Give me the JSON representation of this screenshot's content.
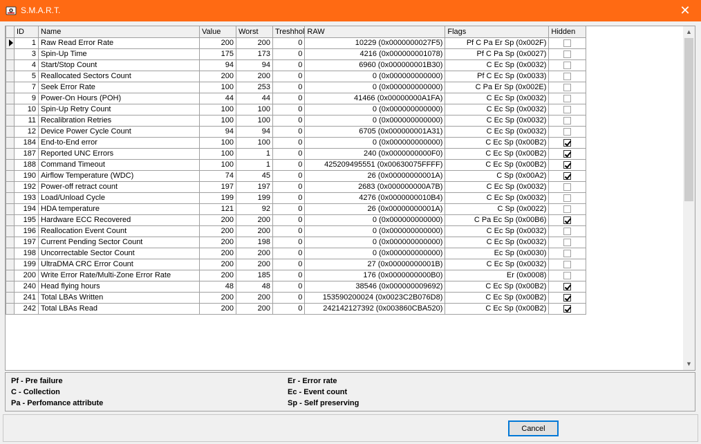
{
  "window": {
    "title": "S.M.A.R.T.",
    "icon": "hard-drive-icon",
    "close_glyph": "✕",
    "accent_color": "#ff6a13"
  },
  "table": {
    "columns": [
      "ID",
      "Name",
      "Value",
      "Worst",
      "Treshhol",
      "RAW",
      "Flags",
      "Hidden"
    ],
    "rows": [
      {
        "id": "1",
        "name": "Raw Read Error Rate",
        "value": "200",
        "worst": "200",
        "threshold": "0",
        "raw": "10229 (0x0000000027F5)",
        "flags": "Pf C Pa Er Sp  (0x002F)",
        "hidden": false
      },
      {
        "id": "3",
        "name": "Spin-Up Time",
        "value": "175",
        "worst": "173",
        "threshold": "0",
        "raw": "4216 (0x000000001078)",
        "flags": "Pf C Pa Sp  (0x0027)",
        "hidden": false
      },
      {
        "id": "4",
        "name": "Start/Stop Count",
        "value": "94",
        "worst": "94",
        "threshold": "0",
        "raw": "6960 (0x000000001B30)",
        "flags": "C Ec Sp  (0x0032)",
        "hidden": false
      },
      {
        "id": "5",
        "name": "Reallocated Sectors Count",
        "value": "200",
        "worst": "200",
        "threshold": "0",
        "raw": "0 (0x000000000000)",
        "flags": "Pf C Ec Sp  (0x0033)",
        "hidden": false
      },
      {
        "id": "7",
        "name": "Seek Error Rate",
        "value": "100",
        "worst": "253",
        "threshold": "0",
        "raw": "0 (0x000000000000)",
        "flags": "C Pa Er Sp  (0x002E)",
        "hidden": false
      },
      {
        "id": "9",
        "name": "Power-On Hours (POH)",
        "value": "44",
        "worst": "44",
        "threshold": "0",
        "raw": "41466 (0x00000000A1FA)",
        "flags": "C Ec Sp  (0x0032)",
        "hidden": false
      },
      {
        "id": "10",
        "name": "Spin-Up Retry Count",
        "value": "100",
        "worst": "100",
        "threshold": "0",
        "raw": "0 (0x000000000000)",
        "flags": "C Ec Sp  (0x0032)",
        "hidden": false
      },
      {
        "id": "11",
        "name": "Recalibration Retries",
        "value": "100",
        "worst": "100",
        "threshold": "0",
        "raw": "0 (0x000000000000)",
        "flags": "C Ec Sp  (0x0032)",
        "hidden": false
      },
      {
        "id": "12",
        "name": "Device Power Cycle Count",
        "value": "94",
        "worst": "94",
        "threshold": "0",
        "raw": "6705 (0x000000001A31)",
        "flags": "C Ec Sp  (0x0032)",
        "hidden": false
      },
      {
        "id": "184",
        "name": "End-to-End error",
        "value": "100",
        "worst": "100",
        "threshold": "0",
        "raw": "0 (0x000000000000)",
        "flags": "C Ec Sp  (0x00B2)",
        "hidden": true
      },
      {
        "id": "187",
        "name": "Reported UNC Errors",
        "value": "100",
        "worst": "1",
        "threshold": "0",
        "raw": "240 (0x0000000000F0)",
        "flags": "C Ec Sp  (0x00B2)",
        "hidden": true
      },
      {
        "id": "188",
        "name": "Command Timeout",
        "value": "100",
        "worst": "1",
        "threshold": "0",
        "raw": "425209495551 (0x00630075FFFF)",
        "flags": "C Ec Sp  (0x00B2)",
        "hidden": true
      },
      {
        "id": "190",
        "name": "Airflow Temperature (WDC)",
        "value": "74",
        "worst": "45",
        "threshold": "0",
        "raw": "26 (0x00000000001A)",
        "flags": "C Sp  (0x00A2)",
        "hidden": true
      },
      {
        "id": "192",
        "name": "Power-off retract count",
        "value": "197",
        "worst": "197",
        "threshold": "0",
        "raw": "2683 (0x000000000A7B)",
        "flags": "C Ec Sp  (0x0032)",
        "hidden": false
      },
      {
        "id": "193",
        "name": "Load/Unload Cycle",
        "value": "199",
        "worst": "199",
        "threshold": "0",
        "raw": "4276 (0x0000000010B4)",
        "flags": "C Ec Sp  (0x0032)",
        "hidden": false
      },
      {
        "id": "194",
        "name": "HDA temperature",
        "value": "121",
        "worst": "92",
        "threshold": "0",
        "raw": "26 (0x00000000001A)",
        "flags": "C Sp  (0x0022)",
        "hidden": false
      },
      {
        "id": "195",
        "name": "Hardware ECC Recovered",
        "value": "200",
        "worst": "200",
        "threshold": "0",
        "raw": "0 (0x000000000000)",
        "flags": "C Pa Ec Sp  (0x00B6)",
        "hidden": true
      },
      {
        "id": "196",
        "name": "Reallocation Event Count",
        "value": "200",
        "worst": "200",
        "threshold": "0",
        "raw": "0 (0x000000000000)",
        "flags": "C Ec Sp  (0x0032)",
        "hidden": false
      },
      {
        "id": "197",
        "name": "Current Pending Sector Count",
        "value": "200",
        "worst": "198",
        "threshold": "0",
        "raw": "0 (0x000000000000)",
        "flags": "C Ec Sp  (0x0032)",
        "hidden": false
      },
      {
        "id": "198",
        "name": "Uncorrectable Sector Count",
        "value": "200",
        "worst": "200",
        "threshold": "0",
        "raw": "0 (0x000000000000)",
        "flags": "Ec Sp  (0x0030)",
        "hidden": false
      },
      {
        "id": "199",
        "name": "UltraDMA CRC Error Count",
        "value": "200",
        "worst": "200",
        "threshold": "0",
        "raw": "27 (0x00000000001B)",
        "flags": "C Ec Sp  (0x0032)",
        "hidden": false
      },
      {
        "id": "200",
        "name": "Write Error Rate/Multi-Zone Error Rate",
        "value": "200",
        "worst": "185",
        "threshold": "0",
        "raw": "176 (0x0000000000B0)",
        "flags": "Er  (0x0008)",
        "hidden": false
      },
      {
        "id": "240",
        "name": "Head flying hours",
        "value": "48",
        "worst": "48",
        "threshold": "0",
        "raw": "38546 (0x000000009692)",
        "flags": "C Ec Sp  (0x00B2)",
        "hidden": true
      },
      {
        "id": "241",
        "name": "Total LBAs Written",
        "value": "200",
        "worst": "200",
        "threshold": "0",
        "raw": "153590200024 (0x0023C2B076D8)",
        "flags": "C Ec Sp  (0x00B2)",
        "hidden": true
      },
      {
        "id": "242",
        "name": "Total LBAs Read",
        "value": "200",
        "worst": "200",
        "threshold": "0",
        "raw": "242142127392 (0x003860CBA520)",
        "flags": "C Ec Sp  (0x00B2)",
        "hidden": true
      }
    ]
  },
  "legend": {
    "pf": "Pf - Pre failure",
    "c": "C - Collection",
    "pa": "Pa - Perfomance attribute",
    "er": "Er - Error rate",
    "ec": "Ec - Event count",
    "sp": "Sp - Self preserving"
  },
  "footer": {
    "cancel_label": "Cancel"
  }
}
